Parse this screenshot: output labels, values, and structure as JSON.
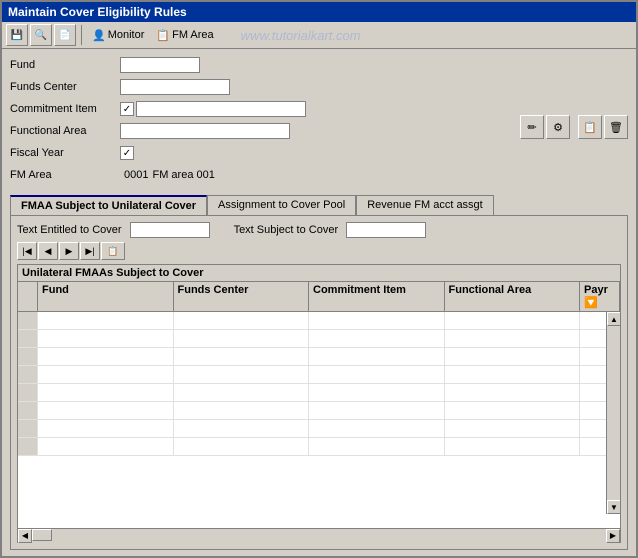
{
  "window": {
    "title": "Maintain Cover Eligibility Rules"
  },
  "toolbar": {
    "buttons": [
      {
        "name": "save-btn",
        "icon": "💾",
        "label": "Save"
      },
      {
        "name": "find-btn",
        "icon": "🔍",
        "label": "Find"
      },
      {
        "name": "print-btn",
        "icon": "🖨",
        "label": "Print"
      },
      {
        "name": "monitor-btn",
        "label": "Monitor"
      },
      {
        "name": "fmarea-btn",
        "label": "FM Area"
      }
    ]
  },
  "watermark": "www.tutorialkart.com",
  "form": {
    "fund_label": "Fund",
    "funds_center_label": "Funds Center",
    "commitment_item_label": "Commitment Item",
    "functional_area_label": "Functional Area",
    "fiscal_year_label": "Fiscal Year",
    "fm_area_label": "FM Area",
    "fm_area_value": "0001",
    "fm_area_text": "FM area 001"
  },
  "right_buttons": {
    "edit": "✏",
    "settings": "⚙",
    "copy": "📋",
    "delete": "🗑"
  },
  "tabs": [
    {
      "id": "tab1",
      "label": "FMAA Subject to Unilateral Cover",
      "active": true
    },
    {
      "id": "tab2",
      "label": "Assignment to Cover Pool",
      "active": false
    },
    {
      "id": "tab3",
      "label": "Revenue FM acct assgt",
      "active": false
    }
  ],
  "tab_content": {
    "text_entitled_label": "Text Entitled to Cover",
    "text_subject_label": "Text Subject to Cover",
    "grid_title": "Unilateral FMAAs Subject to Cover",
    "columns": [
      {
        "id": "fund",
        "label": "Fund"
      },
      {
        "id": "funds_center",
        "label": "Funds Center"
      },
      {
        "id": "commitment_item",
        "label": "Commitment Item"
      },
      {
        "id": "functional_area",
        "label": "Functional Area"
      },
      {
        "id": "payr",
        "label": "Payr"
      }
    ],
    "rows": [
      {
        "fund": "",
        "funds_center": "",
        "commitment_item": "",
        "functional_area": "",
        "payr": ""
      },
      {
        "fund": "",
        "funds_center": "",
        "commitment_item": "",
        "functional_area": "",
        "payr": ""
      },
      {
        "fund": "",
        "funds_center": "",
        "commitment_item": "",
        "functional_area": "",
        "payr": ""
      },
      {
        "fund": "",
        "funds_center": "",
        "commitment_item": "",
        "functional_area": "",
        "payr": ""
      },
      {
        "fund": "",
        "funds_center": "",
        "commitment_item": "",
        "functional_area": "",
        "payr": ""
      },
      {
        "fund": "",
        "funds_center": "",
        "commitment_item": "",
        "functional_area": "",
        "payr": ""
      },
      {
        "fund": "",
        "funds_center": "",
        "commitment_item": "",
        "functional_area": "",
        "payr": ""
      },
      {
        "fund": "",
        "funds_center": "",
        "commitment_item": "",
        "functional_area": "",
        "payr": ""
      }
    ]
  },
  "mini_toolbar_buttons": [
    {
      "name": "first",
      "icon": "◀◀"
    },
    {
      "name": "prev",
      "icon": "◀"
    },
    {
      "name": "next",
      "icon": "▶"
    },
    {
      "name": "last",
      "icon": "▶▶"
    },
    {
      "name": "insert",
      "icon": "+"
    }
  ]
}
